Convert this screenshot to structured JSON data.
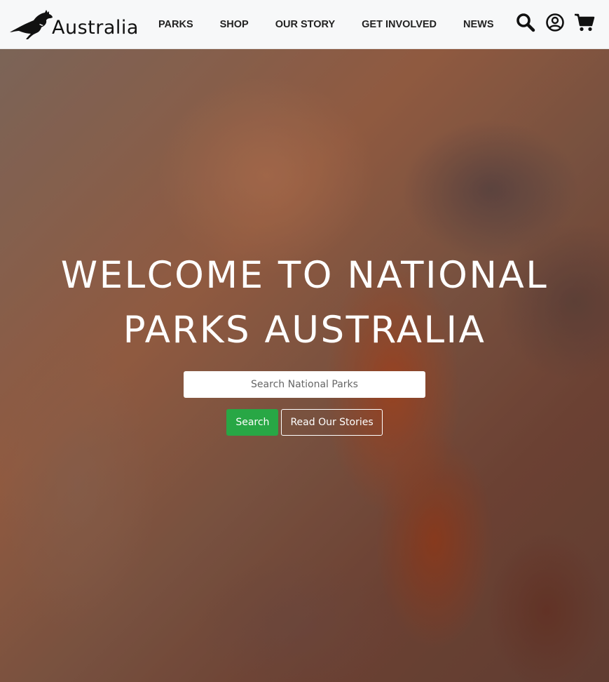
{
  "brand": {
    "name": "Australia",
    "logo_icon": "kangaroo-icon"
  },
  "nav": {
    "links": [
      {
        "label": "PARKS"
      },
      {
        "label": "SHOP"
      },
      {
        "label": "OUR STORY"
      },
      {
        "label": "GET INVOLVED"
      },
      {
        "label": "NEWS"
      }
    ],
    "icons": [
      "search-icon",
      "user-circle-icon",
      "cart-icon"
    ]
  },
  "hero": {
    "title_line1": "WELCOME TO NATIONAL",
    "title_line2": "PARKS AUSTRALIA",
    "search_placeholder": "Search National Parks",
    "search_value": "",
    "search_button": "Search",
    "stories_button": "Read Our Stories"
  },
  "colors": {
    "navbar_bg": "#f7f8f9",
    "primary_button": "#28a745",
    "text_on_hero": "#ffffff"
  }
}
